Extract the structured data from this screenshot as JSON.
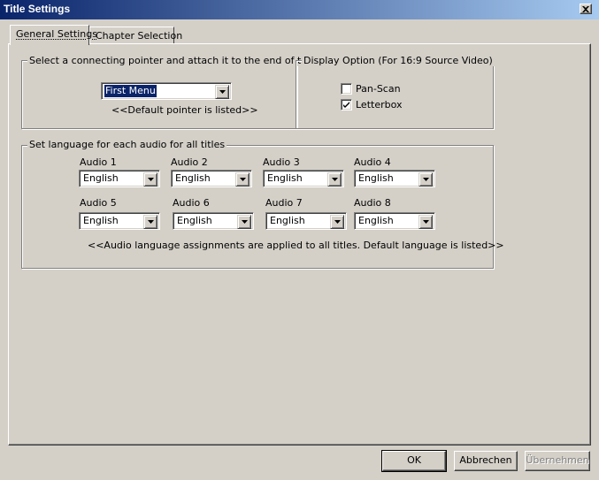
{
  "window": {
    "title": "Title Settings"
  },
  "tabs": [
    {
      "label": "General Settings"
    },
    {
      "label": "Chapter Selection"
    }
  ],
  "pointer_group": {
    "label": "Select a connecting pointer and attach it to the end of this title",
    "selected": "First Menu",
    "note": "<<Default pointer is listed>>"
  },
  "display_group": {
    "label": "Display Option (For 16:9 Source Video)",
    "options": [
      {
        "label": "Pan-Scan",
        "checked": false
      },
      {
        "label": "Letterbox",
        "checked": true
      }
    ]
  },
  "audio_group": {
    "label": "Set language for each audio for all titles",
    "audios": [
      {
        "label": "Audio 1",
        "value": "English"
      },
      {
        "label": "Audio 2",
        "value": "English"
      },
      {
        "label": "Audio 3",
        "value": "English"
      },
      {
        "label": "Audio 4",
        "value": "English"
      },
      {
        "label": "Audio 5",
        "value": "English"
      },
      {
        "label": "Audio 6",
        "value": "English"
      },
      {
        "label": "Audio 7",
        "value": "English"
      },
      {
        "label": "Audio 8",
        "value": "English"
      }
    ],
    "note": "<<Audio language assignments are applied to all titles. Default language is listed>>"
  },
  "buttons": {
    "ok": "OK",
    "cancel": "Abbrechen",
    "apply": "Übernehmen"
  },
  "icons": {
    "close": "close-icon",
    "dropdown": "chevron-down-icon",
    "check": "checkmark-icon"
  }
}
